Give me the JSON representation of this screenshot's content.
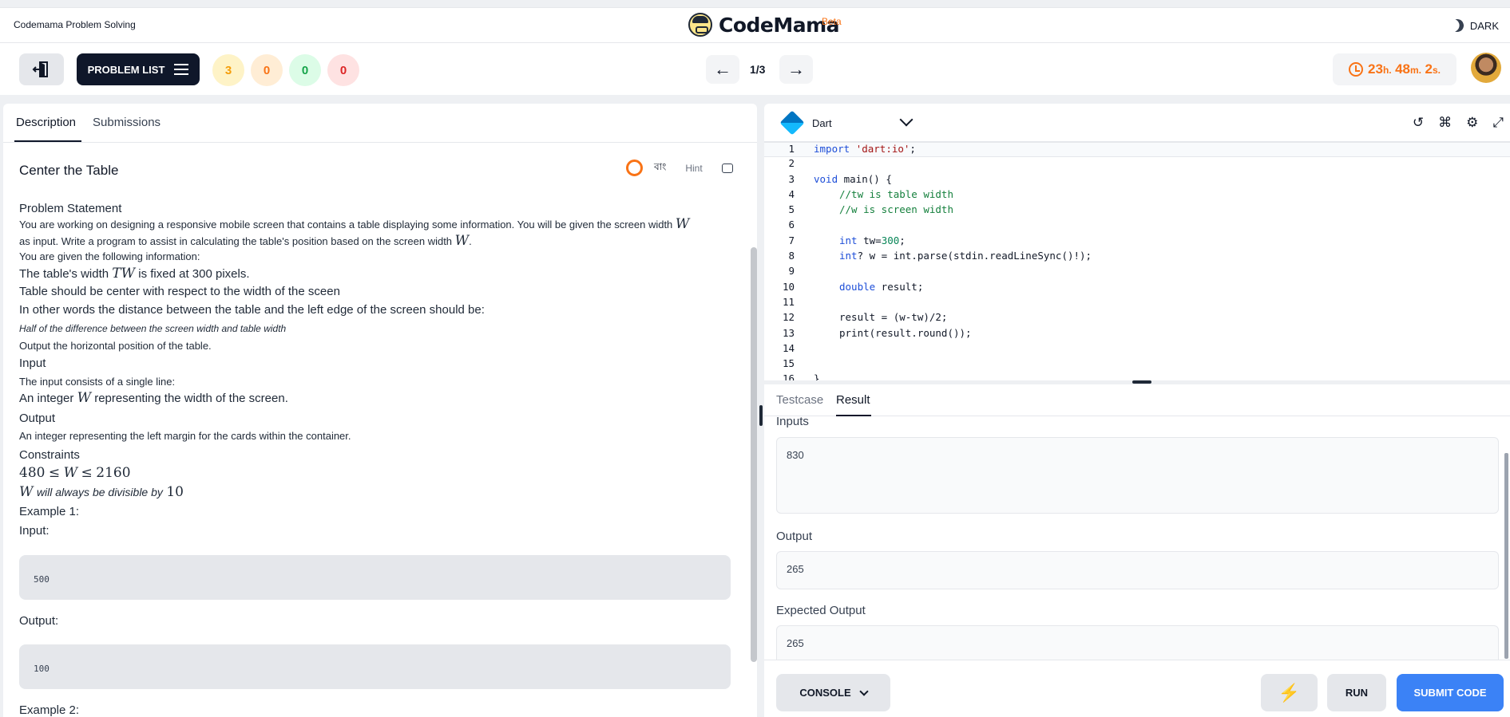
{
  "header": {
    "app_name": "Codemama Problem Solving",
    "logo_text": "CodeMama",
    "beta": "Beta",
    "theme_label": "DARK"
  },
  "toolbar": {
    "problem_list_label": "PROBLEM LIST",
    "counters": [
      {
        "value": "3",
        "bg": "#fef3c7",
        "fg": "#f59e0b"
      },
      {
        "value": "0",
        "bg": "#ffedd5",
        "fg": "#f97316"
      },
      {
        "value": "0",
        "bg": "#dcfce7",
        "fg": "#16a34a"
      },
      {
        "value": "0",
        "bg": "#fee2e2",
        "fg": "#dc2626"
      }
    ],
    "pager": "1/3",
    "timer": {
      "hours": "23",
      "h": "h.",
      "minutes": "48",
      "m": "m.",
      "seconds": "2",
      "s": "s."
    }
  },
  "left": {
    "tabs": [
      "Description",
      "Submissions"
    ],
    "title": "Center the Table",
    "lang_toggle": "বাং",
    "hint": "Hint",
    "statement_heading": "Problem Statement",
    "s1a": "You are working on designing a responsive mobile screen that contains a table displaying some information. You will be given the screen width",
    "s1_math": "W",
    "s2a": "as input. Write a program to assist in calculating the table's position based on the screen width",
    "s2_math": "W",
    "s2b": ".",
    "s3": "You are given the following information:",
    "s4a": "The table's width",
    "s4_math": "TW",
    "s4b": "is fixed at 300 pixels.",
    "s5": "Table should be center with respect to the width of the sceen",
    "s6": "In other words the distance between the table and the left edge of the screen should be:",
    "s7": "Half of the difference between the screen width and table width",
    "s8": "Output the horizontal position of the table.",
    "input_heading": "Input",
    "i1": "The input consists of a single line:",
    "i2a": "An integer",
    "i2_math": "W",
    "i2b": "representing the width of the screen.",
    "output_heading": "Output",
    "o1": "An integer representing the left margin for the cards within the container.",
    "constraints_heading": "Constraints",
    "c1_a": "480",
    "c1_b": "≤",
    "c1_c": "W",
    "c1_d": "≤",
    "c1_e": "2160",
    "c2_math": "W",
    "c2_text": "will always be divisible by",
    "c2_num": "10",
    "ex1_heading": "Example 1:",
    "ex1_input_label": "Input:",
    "ex1_input": "500",
    "ex1_output_label": "Output:",
    "ex1_output": "100",
    "ex2_heading": "Example 2:"
  },
  "editor": {
    "language": "Dart",
    "lines": [
      "1",
      "2",
      "3",
      "4",
      "5",
      "6",
      "7",
      "8",
      "9",
      "10",
      "11",
      "12",
      "13",
      "14",
      "15",
      "16"
    ],
    "code": {
      "l1_kw": "import",
      "l1_str": "'dart:io'",
      "l1_end": ";",
      "l3_kw": "void",
      "l3_rest": " main() {",
      "l4": "//tw is table width",
      "l5": "//w is screen width",
      "l7_kw": "int",
      "l7_a": " tw=",
      "l7_num": "300",
      "l7_end": ";",
      "l8_kw": "int",
      "l8_rest": "? w = int.parse(stdin.readLineSync()!);",
      "l10_kw": "double",
      "l10_rest": " result;",
      "l12": "result = (w-tw)/2;",
      "l13": "print(result.round());",
      "l16": "}"
    }
  },
  "result": {
    "tabs": [
      "Testcase",
      "Result"
    ],
    "inputs_label": "Inputs",
    "inputs_value": "830",
    "output_label": "Output",
    "output_value": "265",
    "expected_label": "Expected Output",
    "expected_value": "265"
  },
  "footer": {
    "console_label": "CONSOLE",
    "run_label": "RUN",
    "submit_label": "SUBMIT CODE"
  }
}
